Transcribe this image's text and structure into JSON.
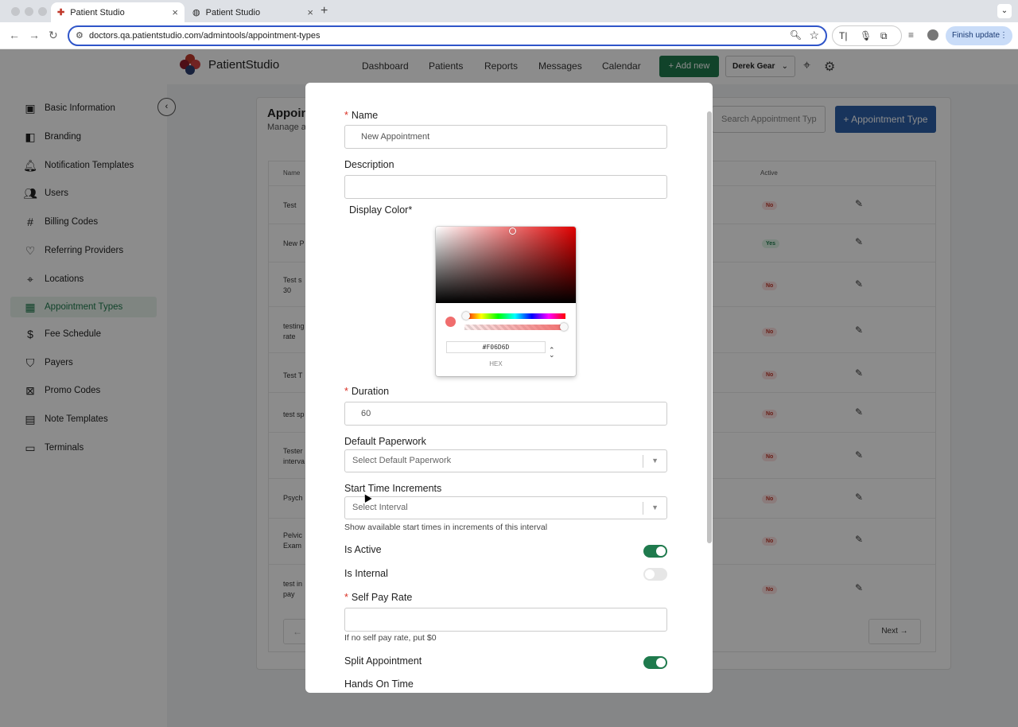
{
  "browser": {
    "tabs": [
      {
        "title": "Patient Studio",
        "active": true
      },
      {
        "title": "Patient Studio",
        "active": false
      }
    ],
    "url": "doctors.qa.patientstudio.com/admintools/appointment-types",
    "finish_update": "Finish update"
  },
  "header": {
    "brand": "PatientStudio",
    "nav": [
      "Dashboard",
      "Patients",
      "Reports",
      "Messages",
      "Calendar"
    ],
    "add_new": "Add new",
    "user": "Derek Gear"
  },
  "sidebar": {
    "items": [
      {
        "label": "Basic Information",
        "icon": "id-card-icon"
      },
      {
        "label": "Branding",
        "icon": "branding-icon"
      },
      {
        "label": "Notification Templates",
        "icon": "bell-icon"
      },
      {
        "label": "Users",
        "icon": "users-icon"
      },
      {
        "label": "Billing Codes",
        "icon": "hash-icon"
      },
      {
        "label": "Referring Providers",
        "icon": "heart-icon"
      },
      {
        "label": "Locations",
        "icon": "location-pin-icon"
      },
      {
        "label": "Appointment Types",
        "icon": "calendar-icon",
        "active": true
      },
      {
        "label": "Fee Schedule",
        "icon": "dollar-icon"
      },
      {
        "label": "Payers",
        "icon": "shield-icon"
      },
      {
        "label": "Promo Codes",
        "icon": "promo-icon"
      },
      {
        "label": "Note Templates",
        "icon": "template-icon"
      },
      {
        "label": "Terminals",
        "icon": "card-icon"
      }
    ]
  },
  "page": {
    "title": "Appoin",
    "subtitle": "Manage a",
    "search_placeholder": "Search Appointment Typ",
    "add_type": "+ Appointment Type",
    "table": {
      "headers": {
        "name": "Name",
        "active": "Active"
      },
      "rows": [
        {
          "name": "Test",
          "active": "No"
        },
        {
          "name": "New P",
          "active": "Yes"
        },
        {
          "name": "Test s\n30",
          "active": "No"
        },
        {
          "name": "testing\nrate",
          "active": "No"
        },
        {
          "name": "Test T",
          "active": "No"
        },
        {
          "name": "test sp",
          "active": "No"
        },
        {
          "name": "Tester\ninterva",
          "active": "No"
        },
        {
          "name": "Psych",
          "active": "No"
        },
        {
          "name": "Pelvic\nExam",
          "active": "No"
        },
        {
          "name": "test in\npay",
          "active": "No"
        }
      ]
    },
    "next": "Next"
  },
  "modal": {
    "name_label": "Name",
    "name_placeholder": "New Appointment",
    "description_label": "Description",
    "display_color_label": "Display Color*",
    "color_picker": {
      "hex": "#F06D6D",
      "mode_label": "HEX",
      "color": "#F06D6D"
    },
    "duration_label": "Duration",
    "duration_value": "60",
    "paperwork_label": "Default Paperwork",
    "paperwork_placeholder": "Select Default Paperwork",
    "increments_label": "Start Time Increments",
    "increments_placeholder": "Select Interval",
    "increments_help": "Show available start times in increments of this interval",
    "is_active_label": "Is Active",
    "is_active": true,
    "is_internal_label": "Is Internal",
    "is_internal": false,
    "self_pay_label": "Self Pay Rate",
    "self_pay_help": "If no self pay rate, put $0",
    "split_label": "Split Appointment",
    "split": true,
    "hands_on_label": "Hands On Time"
  },
  "colors": {
    "brand_green": "#1f7a4d",
    "brand_blue": "#2c5fa8",
    "required": "#d93025"
  }
}
